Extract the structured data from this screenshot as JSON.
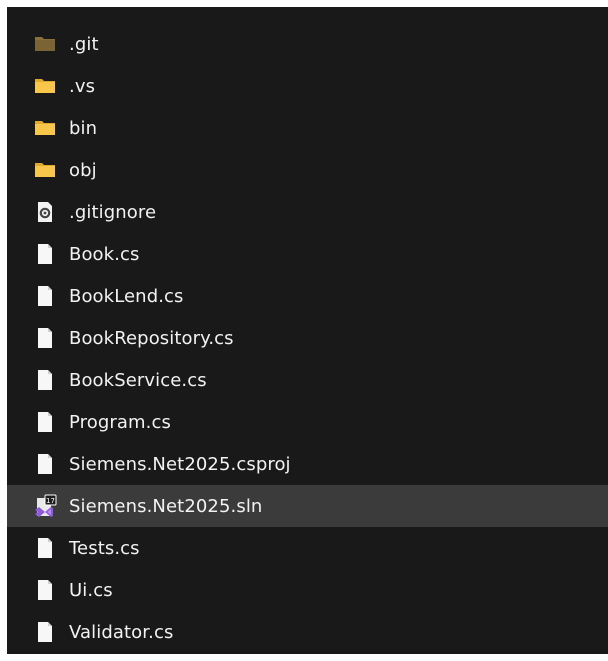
{
  "explorer": {
    "items": [
      {
        "name": ".git",
        "icon": "folder-dim-icon",
        "selected": false
      },
      {
        "name": ".vs",
        "icon": "folder-icon",
        "selected": false
      },
      {
        "name": "bin",
        "icon": "folder-icon",
        "selected": false
      },
      {
        "name": "obj",
        "icon": "folder-icon",
        "selected": false
      },
      {
        "name": ".gitignore",
        "icon": "config-file-icon",
        "selected": false
      },
      {
        "name": "Book.cs",
        "icon": "file-icon",
        "selected": false
      },
      {
        "name": "BookLend.cs",
        "icon": "file-icon",
        "selected": false
      },
      {
        "name": "BookRepository.cs",
        "icon": "file-icon",
        "selected": false
      },
      {
        "name": "BookService.cs",
        "icon": "file-icon",
        "selected": false
      },
      {
        "name": "Program.cs",
        "icon": "file-icon",
        "selected": false
      },
      {
        "name": "Siemens.Net2025.csproj",
        "icon": "file-icon",
        "selected": false
      },
      {
        "name": "Siemens.Net2025.sln",
        "icon": "visual-studio-solution-icon",
        "selected": true
      },
      {
        "name": "Tests.cs",
        "icon": "file-icon",
        "selected": false
      },
      {
        "name": "Ui.cs",
        "icon": "file-icon",
        "selected": false
      },
      {
        "name": "Validator.cs",
        "icon": "file-icon",
        "selected": false
      }
    ]
  },
  "colors": {
    "background": "#191919",
    "selected_row": "#3b3b3b",
    "text": "#f2f2f2",
    "folder": "#f8c64a",
    "folder_dim": "#8a6f3a"
  }
}
